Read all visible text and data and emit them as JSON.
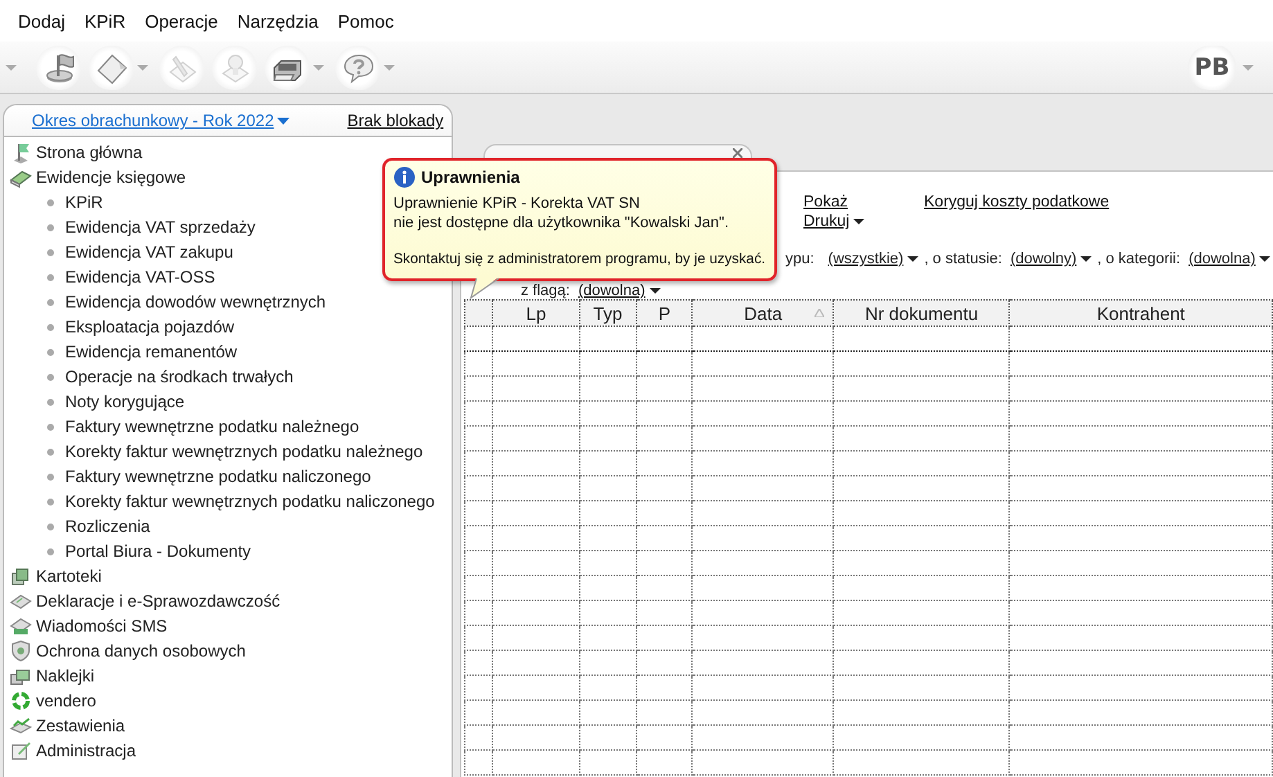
{
  "menu": [
    "Dodaj",
    "KPiR",
    "Operacje",
    "Narzędzia",
    "Pomoc"
  ],
  "toolbar": {
    "buttons": [
      {
        "disabled": false,
        "dropdown": false
      },
      {
        "disabled": false,
        "dropdown": true
      },
      {
        "disabled": true,
        "dropdown": false
      },
      {
        "disabled": true,
        "dropdown": false
      },
      {
        "disabled": false,
        "dropdown": true
      },
      {
        "disabled": false,
        "dropdown": true
      }
    ],
    "user": {
      "initials": "PB"
    }
  },
  "sidebar": {
    "period": "Okres obrachunkowy - Rok 2022",
    "lock": "Brak blokady",
    "items": [
      {
        "label": "Strona główna"
      },
      {
        "label": "Ewidencje księgowe",
        "children": [
          {
            "label": "KPiR"
          },
          {
            "label": "Ewidencja VAT sprzedaży"
          },
          {
            "label": "Ewidencja VAT zakupu"
          },
          {
            "label": "Ewidencja VAT-OSS"
          },
          {
            "label": "Ewidencja dowodów wewnętrznych"
          },
          {
            "label": "Eksploatacja pojazdów"
          },
          {
            "label": "Ewidencja remanentów"
          },
          {
            "label": "Operacje na środkach trwałych"
          },
          {
            "label": "Noty korygujące"
          },
          {
            "label": "Faktury wewnętrzne podatku należnego"
          },
          {
            "label": "Korekty faktur wewnętrznych podatku należnego"
          },
          {
            "label": "Faktury wewnętrzne podatku naliczonego"
          },
          {
            "label": "Korekty faktur wewnętrznych podatku naliczonego"
          },
          {
            "label": "Rozliczenia"
          },
          {
            "label": "Portal Biura - Dokumenty"
          }
        ]
      },
      {
        "label": "Kartoteki"
      },
      {
        "label": "Deklaracje i e-Sprawozdawczość"
      },
      {
        "label": "Wiadomości SMS"
      },
      {
        "label": "Ochrona danych osobowych"
      },
      {
        "label": "Naklejki"
      },
      {
        "label": "vendero"
      },
      {
        "label": "Zestawienia"
      },
      {
        "label": "Administracja"
      }
    ]
  },
  "document": {
    "actions": {
      "show": "Pokaż",
      "correct": "Koryguj koszty podatkowe",
      "print": "Drukuj"
    },
    "filter": {
      "type_label": "ypu:",
      "type": "(wszystkie)",
      "status_label": ", o statusie:",
      "status": "(dowolny)",
      "category_label": ", o kategorii:",
      "category": "(dowolna)",
      "flag_label": "z flagą:",
      "flag": "(dowolna)"
    },
    "table": {
      "columns": [
        {
          "label": "Lp",
          "sorted": false
        },
        {
          "label": "Typ",
          "sorted": false
        },
        {
          "label": "P",
          "sorted": false
        },
        {
          "label": "Data",
          "sorted": true
        },
        {
          "label": "Nr dokumentu",
          "sorted": false
        },
        {
          "label": "Kontrahent",
          "sorted": false
        }
      ]
    }
  },
  "tooltip": {
    "title": "Uprawnienia",
    "message": "Uprawnienie KPiR - Korekta VAT SN\nnie jest dostępne dla użytkownika \"Kowalski Jan\".",
    "hint": "Skontaktuj się z administratorem programu, by je uzyskać."
  }
}
